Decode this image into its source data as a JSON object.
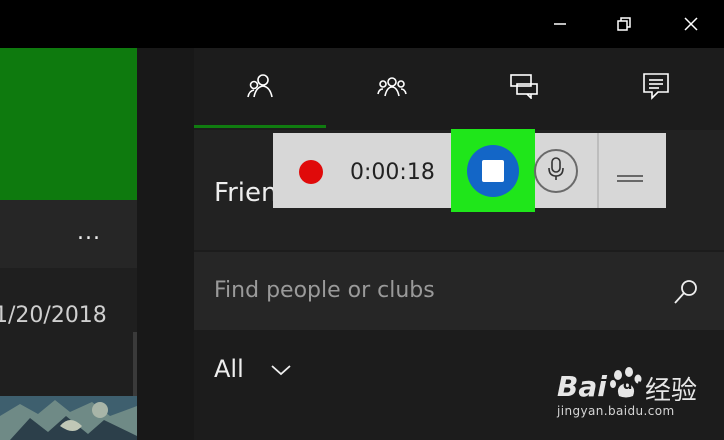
{
  "window": {
    "controls": [
      "minimize-icon",
      "restore-icon",
      "close-icon"
    ]
  },
  "left_panel": {
    "more_label": "...",
    "date": "1/20/2018"
  },
  "tabs": [
    {
      "icon": "friends-icon",
      "active": true
    },
    {
      "icon": "party-icon",
      "active": false
    },
    {
      "icon": "messages-icon",
      "active": false
    },
    {
      "icon": "activity-feed-icon",
      "active": false
    }
  ],
  "main": {
    "friends_title": "Frien",
    "search": {
      "value": "",
      "placeholder": "Find people or clubs"
    },
    "filter": {
      "label": "All"
    }
  },
  "recording_bar": {
    "elapsed": "0:00:18",
    "recording_indicator_color": "#e00a0a",
    "stop_button_color": "#1366c7",
    "highlight_color": "#1fe61a"
  },
  "watermark": {
    "brand_latin": "Bai",
    "brand_suffix": "du",
    "brand_chinese": "经验",
    "url": "jingyan.baidu.com"
  },
  "colors": {
    "accent_green": "#107c10",
    "tile_green": "#0e7a0e"
  }
}
